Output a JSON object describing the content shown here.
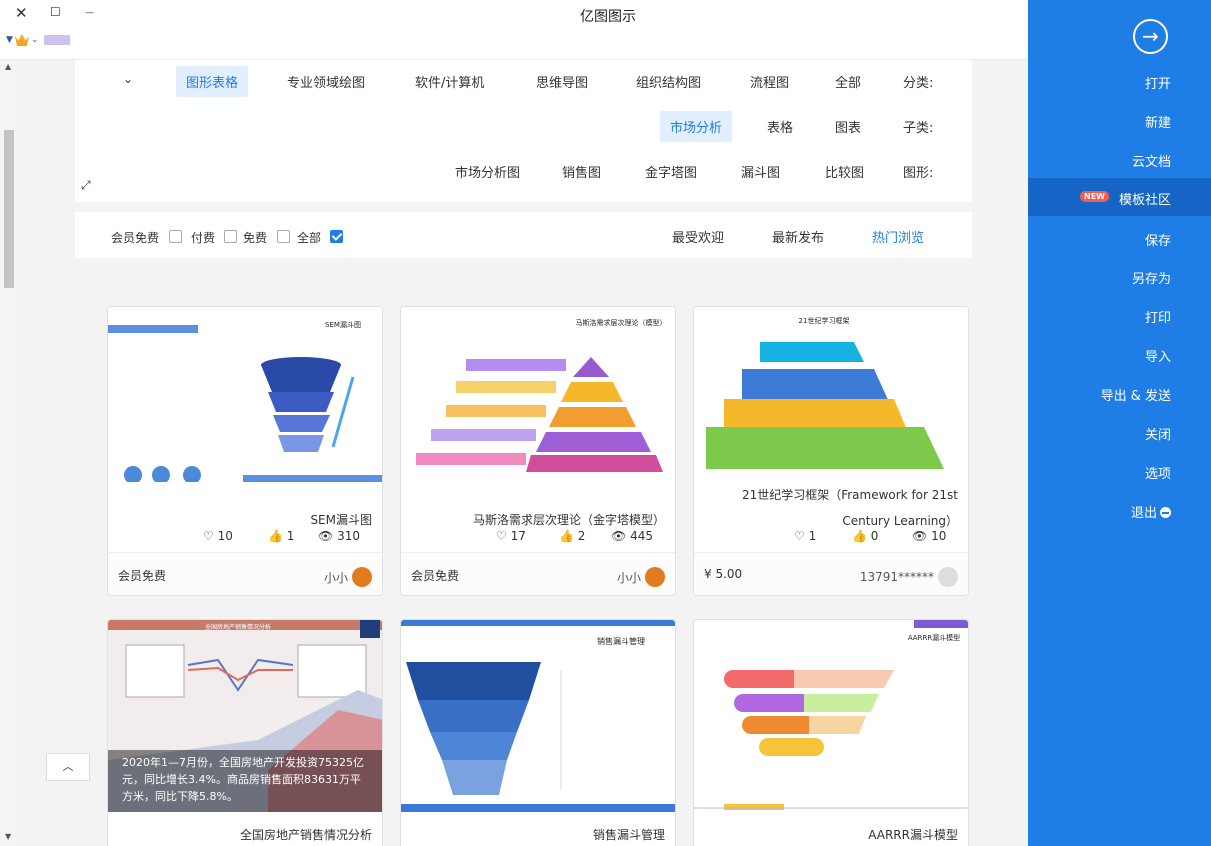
{
  "window": {
    "title": "亿图图示",
    "close": "✕",
    "maximize": "☐",
    "minimize": "—"
  },
  "sidebar": {
    "back_icon": "→",
    "items": [
      {
        "label": "打开"
      },
      {
        "label": "新建"
      },
      {
        "label": "云文档"
      },
      {
        "label": "模板社区",
        "badge": "NEW"
      },
      {
        "label": "保存"
      },
      {
        "label": "另存为"
      },
      {
        "label": "打印"
      },
      {
        "label": "导入"
      },
      {
        "label": "导出 & 发送"
      },
      {
        "label": "关闭"
      },
      {
        "label": "选项"
      },
      {
        "label": "退出"
      }
    ]
  },
  "filter": {
    "category_label": "分类:",
    "categories": [
      "全部",
      "流程图",
      "组织结构图",
      "思维导图",
      "软件/计算机",
      "专业领域绘图",
      "图形表格"
    ],
    "subcat_label": "子类:",
    "subcats": [
      "图表",
      "表格",
      "市场分析"
    ],
    "shape_label": "图形:",
    "shapes": [
      "比较图",
      "漏斗图",
      "金字塔图",
      "销售图",
      "市场分析图"
    ]
  },
  "sort": {
    "items": [
      "热门浏览",
      "最新发布",
      "最受欢迎"
    ],
    "checks": [
      "全部",
      "免费",
      "付费",
      "会员免费"
    ]
  },
  "cards": [
    {
      "title": "21世纪学习框架（Framework for 21st Century Learning）",
      "views": "10",
      "likes": "0",
      "favs": "1",
      "author": "13791******",
      "price": "¥ 5.00"
    },
    {
      "title": "马斯洛需求层次理论（金字塔模型）",
      "views": "445",
      "likes": "2",
      "favs": "17",
      "author": "小小",
      "price": "会员免费"
    },
    {
      "title": "SEM漏斗图",
      "views": "310",
      "likes": "1",
      "favs": "10",
      "author": "小小",
      "price": "会员免费"
    },
    {
      "title": "AARRR漏斗模型"
    },
    {
      "title": "销售漏斗管理"
    },
    {
      "title": "全国房地产销售情况分析",
      "overlay": "2020年1—7月份，全国房地产开发投资75325亿元，同比增长3.4%。商品房销售面积83631万平方米，同比下降5.8%。"
    }
  ],
  "thumb_text": {
    "c1_title": "21世纪学习框架",
    "c2_title": "马斯洛需求层次理论（模型）",
    "c3_title": "SEM漏斗图",
    "c4_title": "AARRR漏斗模型",
    "c5_title": "销售漏斗管理",
    "c6_title": "全国房地产销售情况分析"
  },
  "colors": {
    "accent": "#1f7de6",
    "sidebar": "#1f7de6",
    "badge": "#f25c54"
  }
}
